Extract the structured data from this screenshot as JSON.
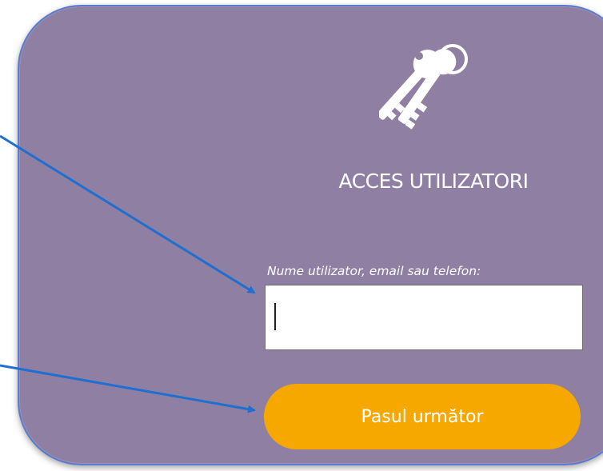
{
  "panel": {
    "background_color": "#8e7fa3",
    "border_color": "#5b7bd0"
  },
  "login": {
    "icon": "keys-icon",
    "title": "ACCES UTILIZATORI",
    "field_label": "Nume utilizator, email sau telefon:",
    "field_value": "",
    "next_button_label": "Pasul următor",
    "button_color": "#f7a800"
  },
  "annotations": {
    "arrow_color": "#1f6fd0",
    "arrows": [
      {
        "points_to": "username-field"
      },
      {
        "points_to": "next-button"
      }
    ]
  }
}
